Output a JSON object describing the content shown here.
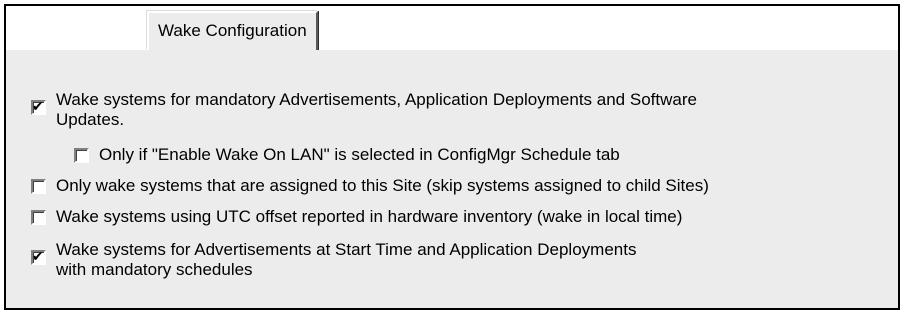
{
  "tabs": [
    {
      "label": "Wake Configuration",
      "selected": true
    }
  ],
  "options": [
    {
      "label": "Wake systems for mandatory Advertisements, Application Deployments and Software\nUpdates.",
      "checked": true
    },
    {
      "label": "Only if \"Enable Wake On LAN\" is selected in ConfigMgr Schedule tab",
      "checked": false
    },
    {
      "label": "Only wake systems that are assigned to this Site (skip systems assigned to child Sites)",
      "checked": false
    },
    {
      "label": "Wake systems using UTC offset reported in hardware inventory (wake in local time)",
      "checked": false
    },
    {
      "label": "Wake systems for Advertisements at Start Time and Application Deployments\nwith mandatory schedules",
      "checked": true
    }
  ],
  "colors": {
    "panel_background": "#ececec",
    "frame_border": "#000000"
  }
}
